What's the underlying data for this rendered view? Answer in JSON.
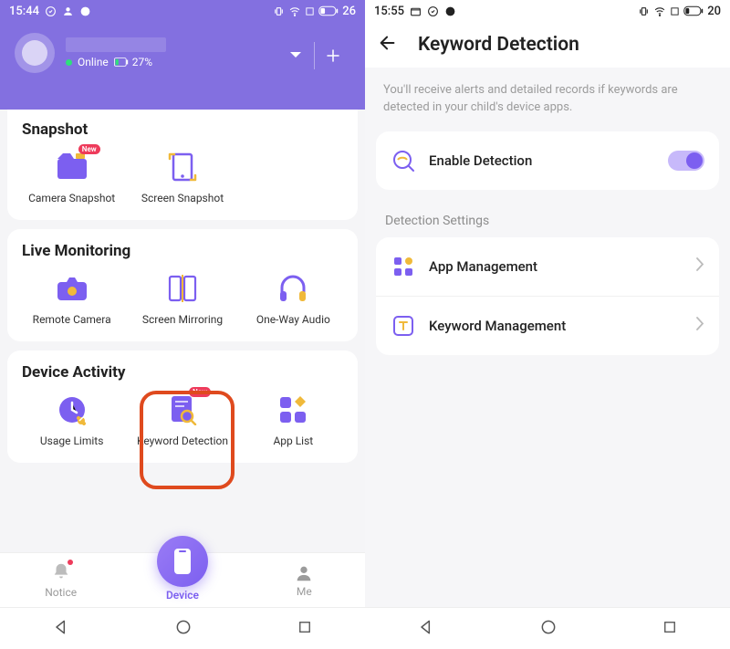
{
  "left": {
    "status": {
      "time": "15:44",
      "battery": "26"
    },
    "profile": {
      "online": "Online",
      "battery_pct": "27%"
    },
    "sections": {
      "snapshot": {
        "title": "Snapshot",
        "items": [
          "Camera Snapshot",
          "Screen Snapshot"
        ]
      },
      "live": {
        "title": "Live Monitoring",
        "items": [
          "Remote Camera",
          "Screen Mirroring",
          "One-Way Audio"
        ]
      },
      "activity": {
        "title": "Device Activity",
        "items": [
          "Usage Limits",
          "Keyword Detection",
          "App List"
        ]
      }
    },
    "tabs": {
      "notice": "Notice",
      "device": "Device",
      "me": "Me"
    },
    "badge_new": "New"
  },
  "right": {
    "status": {
      "time": "15:55",
      "battery": "20"
    },
    "title": "Keyword Detection",
    "subtitle": "You'll receive alerts and detailed records if keywords are detected in your child's device apps.",
    "enable": "Enable Detection",
    "settings_label": "Detection Settings",
    "app_mgmt": "App Management",
    "keyword_mgmt": "Keyword Management"
  }
}
